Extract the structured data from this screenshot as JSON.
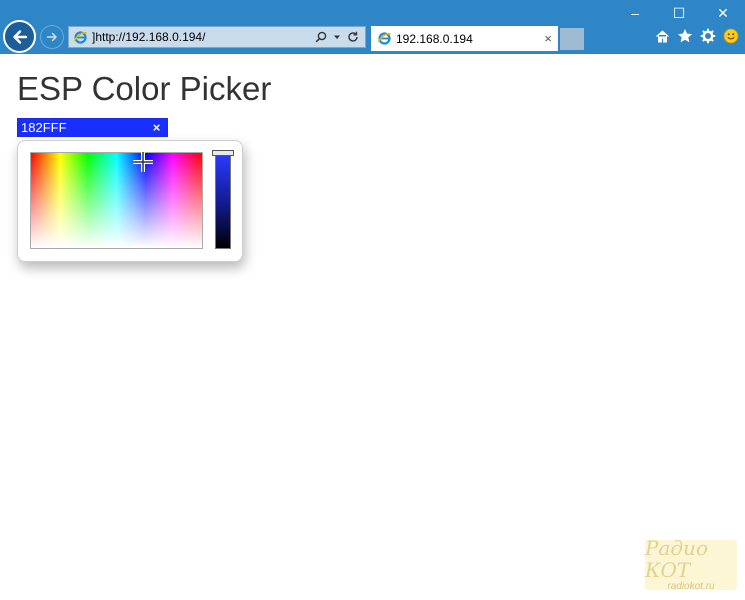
{
  "browser": {
    "address": "]http://192.168.0.194/",
    "tab_title": "192.168.0.194",
    "tab_close": "×",
    "window_controls": [
      "–",
      "☐",
      "✕"
    ],
    "icons": [
      "back-arrow-icon",
      "forward-arrow-icon",
      "ie-logo-icon",
      "search-icon",
      "dropdown-icon",
      "refresh-icon",
      "home-icon",
      "favorites-star-icon",
      "settings-gear-icon",
      "smiley-feedback-icon"
    ]
  },
  "page": {
    "title": "ESP Color Picker",
    "color_value": "182FFF",
    "color_hex": "#182FFF",
    "clear_label": "×"
  },
  "watermark": {
    "logo": "Радио КОТ",
    "url": "radiokot.ru"
  }
}
